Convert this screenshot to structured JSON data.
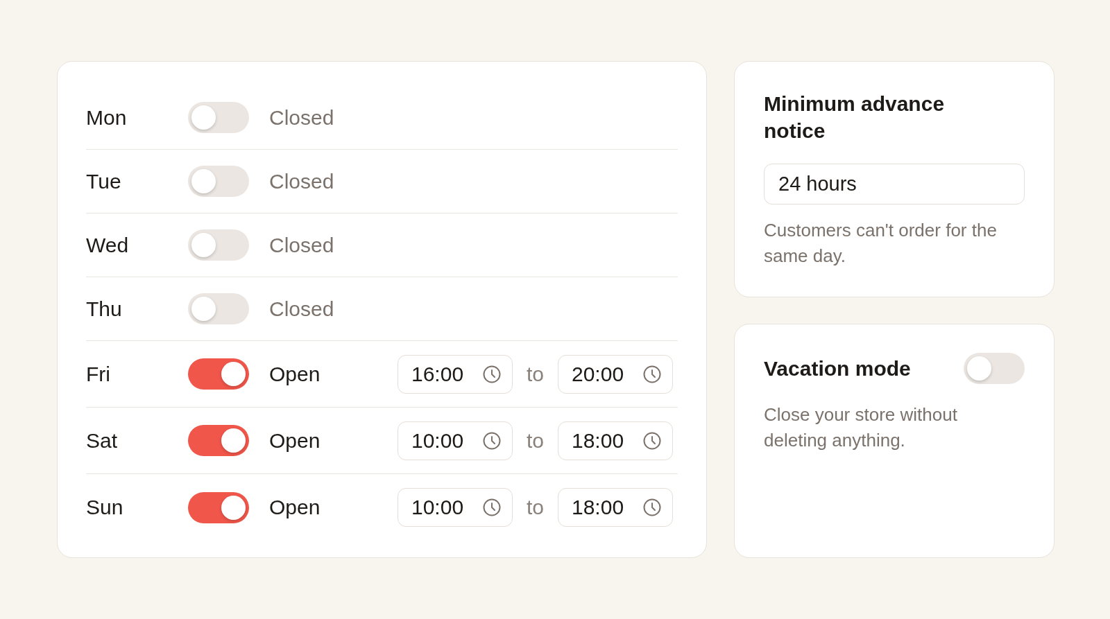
{
  "schedule": {
    "days": [
      {
        "day": "Mon",
        "open": false,
        "status": "Closed"
      },
      {
        "day": "Tue",
        "open": false,
        "status": "Closed"
      },
      {
        "day": "Wed",
        "open": false,
        "status": "Closed"
      },
      {
        "day": "Thu",
        "open": false,
        "status": "Closed"
      },
      {
        "day": "Fri",
        "open": true,
        "status": "Open",
        "from": "16:00",
        "separator": "to",
        "until": "20:00"
      },
      {
        "day": "Sat",
        "open": true,
        "status": "Open",
        "from": "10:00",
        "separator": "to",
        "until": "18:00"
      },
      {
        "day": "Sun",
        "open": true,
        "status": "Open",
        "from": "10:00",
        "separator": "to",
        "until": "18:00"
      }
    ]
  },
  "advance_notice": {
    "title": "Minimum advance notice",
    "value": "24 hours",
    "help": "Customers can't order for the same day."
  },
  "vacation_mode": {
    "title": "Vacation mode",
    "on": false,
    "description": "Close your store without deleting anything."
  }
}
